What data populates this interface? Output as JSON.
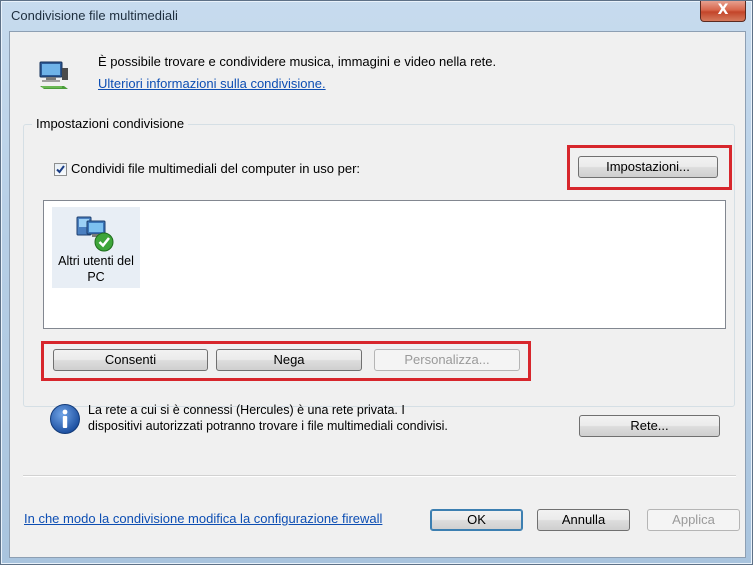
{
  "window": {
    "title": "Condivisione file multimediali",
    "close_label": "X"
  },
  "header": {
    "description": "È possibile trovare e condividere musica, immagini e video nella rete.",
    "more_info_link": "Ulteriori informazioni sulla condivisione."
  },
  "sharing_settings": {
    "group_label": "Impostazioni condivisione",
    "share_checkbox_label": "Condividi file multimediali del computer in uso per:",
    "share_checkbox_checked": true,
    "settings_button": "Impostazioni...",
    "devices": [
      {
        "label": "Altri utenti del PC",
        "icon": "network-computers-check-icon"
      }
    ],
    "allow_button": "Consenti",
    "deny_button": "Nega",
    "customize_button": "Personalizza..."
  },
  "network_info": {
    "text": "La rete a cui si è connessi (Hercules) è una rete privata. I dispositivi autorizzati potranno trovare i file multimediali condivisi.",
    "network_button": "Rete..."
  },
  "footer": {
    "firewall_link": "In che modo la condivisione modifica la configurazione firewall",
    "ok_button": "OK",
    "cancel_button": "Annulla",
    "apply_button": "Applica"
  },
  "colors": {
    "highlight": "#d7262c",
    "link": "#0d4eb3"
  }
}
